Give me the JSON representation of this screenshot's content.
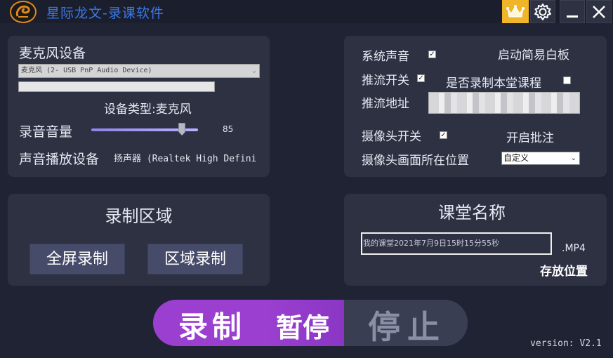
{
  "window": {
    "title": "星际龙文-录课软件"
  },
  "mic": {
    "heading": "麦克风设备",
    "device_select": "麦克风 (2- USB PnP Audio Device)",
    "device_type": "设备类型:麦克风",
    "volume_label": "录音音量",
    "volume_value": "85",
    "volume_level": 0.85,
    "playback_label": "声音播放设备",
    "playback_device": "扬声器 (Realtek High Defini"
  },
  "stream": {
    "system_sound_label": "系统声音",
    "system_sound_checked": true,
    "whiteboard_label": "启动简易白板",
    "push_label": "推流开关",
    "push_checked": true,
    "record_class_label": "是否录制本堂课程",
    "record_class_checked": false,
    "push_url_label": "推流地址",
    "camera_label": "摄像头开关",
    "camera_checked": true,
    "annotate_label": "开启批注",
    "camera_pos_label": "摄像头画面所在位置",
    "camera_pos_value": "自定义"
  },
  "region": {
    "heading": "录制区域",
    "fullscreen_button": "全屏录制",
    "area_button": "区域录制"
  },
  "classroom": {
    "heading": "课堂名称",
    "name_value": "我的课堂2021年7月9日15时15分55秒",
    "extension": ".MP4",
    "save_location": "存放位置"
  },
  "controls": {
    "record": "录制",
    "pause": "暂停",
    "stop": "停止"
  },
  "version": "version: V2.1",
  "colors": {
    "background": "#202333",
    "panel": "#2d3142",
    "title_blue": "#3a78e6",
    "record_purple": "#9a3fd0",
    "crown_gold": "#f1b52a"
  }
}
